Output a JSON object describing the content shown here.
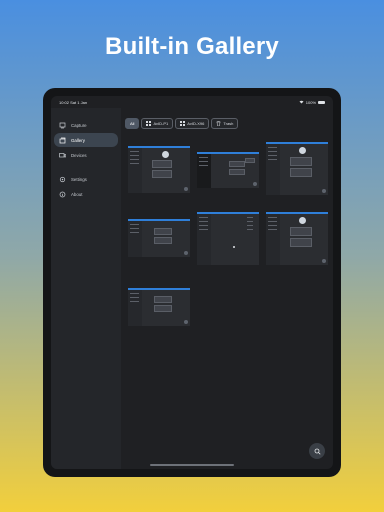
{
  "headline": "Built-in Gallery",
  "status_bar": {
    "time": "10:02",
    "date": "Sat 1 Jan",
    "battery": "100%"
  },
  "sidebar": {
    "items": [
      {
        "label": "Capture",
        "icon": "capture-icon",
        "active": false
      },
      {
        "label": "Gallery",
        "icon": "gallery-icon",
        "active": true
      },
      {
        "label": "Devices",
        "icon": "devices-icon",
        "active": false
      },
      {
        "label": "Settings",
        "icon": "settings-icon",
        "active": false
      },
      {
        "label": "About",
        "icon": "info-icon",
        "active": false
      }
    ]
  },
  "filters": [
    {
      "label": "All",
      "active": true
    },
    {
      "label": "AvID-P1",
      "icon": "grid-icon",
      "active": false
    },
    {
      "label": "AvID-X96",
      "icon": "grid-icon",
      "active": false
    },
    {
      "label": "Trash",
      "icon": "trash-icon",
      "active": false
    }
  ],
  "colors": {
    "accent": "#2f7fd9",
    "screen_bg": "#1f2023",
    "sidebar_bg": "#24262a"
  },
  "fab": {
    "icon": "search-icon"
  }
}
